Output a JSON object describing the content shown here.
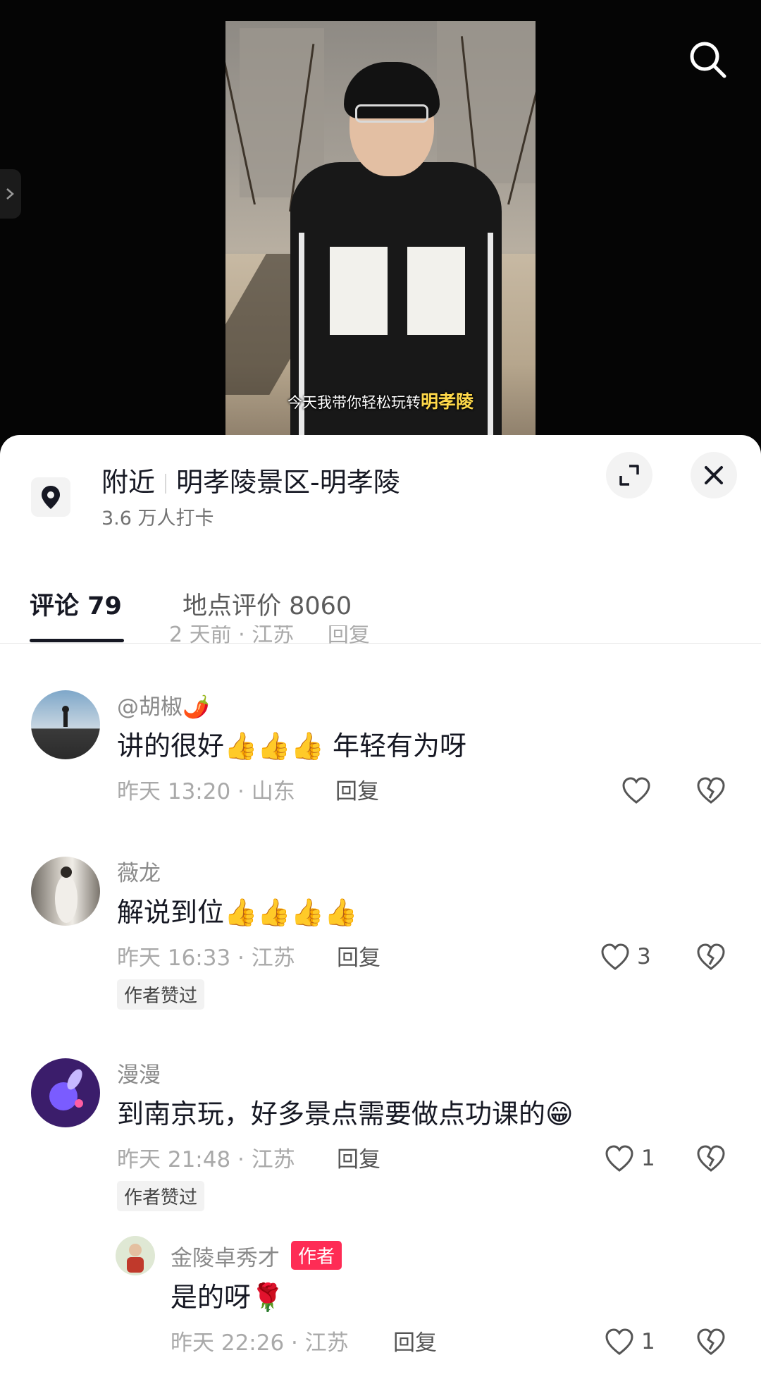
{
  "video": {
    "subtitle_prefix": "今天我带你轻松玩转",
    "subtitle_highlight": "明孝陵"
  },
  "header": {
    "location_label": "附近",
    "location_name": "明孝陵景区-明孝陵",
    "checkin_count": "3.6 万人打卡",
    "icons": [
      "search-icon",
      "chevron-right-icon",
      "location-pin-icon",
      "expand-icon",
      "close-icon"
    ]
  },
  "tabs": [
    {
      "label": "评论 79",
      "active": true
    },
    {
      "label": "地点评价 8060",
      "active": false
    }
  ],
  "previous_comment_meta": "2 天前 · 江苏     回复",
  "comments": [
    {
      "username": "@胡椒🌶️",
      "text": "讲的很好👍👍👍 年轻有为呀",
      "time_location": "昨天 13:20 · 山东",
      "reply_label": "回复",
      "likes": ""
    },
    {
      "username": "薇龙",
      "text": "解说到位👍👍👍👍",
      "time_location": "昨天 16:33 · 江苏",
      "reply_label": "回复",
      "likes": "3",
      "badge": "作者赞过"
    },
    {
      "username": "漫漫",
      "text": "到南京玩，好多景点需要做点功课的😁",
      "time_location": "昨天 21:48 · 江苏",
      "reply_label": "回复",
      "likes": "1",
      "badge": "作者赞过"
    },
    {
      "username": "金陵卓秀才",
      "author_tag": "作者",
      "text": "是的呀🌹",
      "time_location": "昨天 22:26 · 江苏",
      "reply_label": "回复",
      "likes": "1"
    }
  ],
  "colors": {
    "sheet_bg": "#ffffff",
    "text_primary": "#161823",
    "text_secondary": "#a9a9a9",
    "author_tag": "#fe2c55"
  }
}
